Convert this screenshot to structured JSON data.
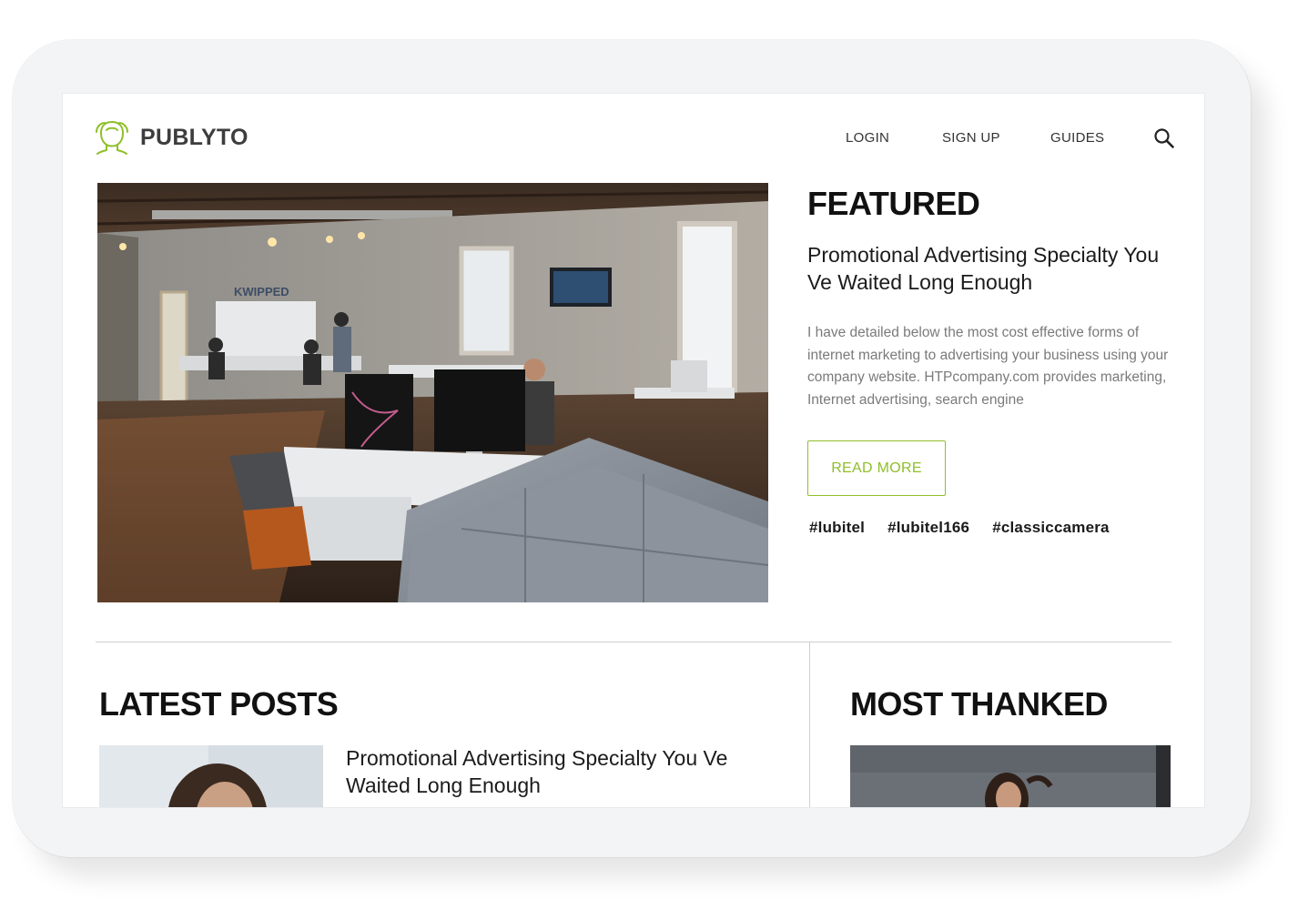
{
  "brand": {
    "name": "PUBLYTO",
    "accent_color": "#8fbf2a"
  },
  "nav": {
    "login": "LOGIN",
    "signup": "SIGN UP",
    "guides": "GUIDES",
    "search_icon": "search-icon"
  },
  "featured": {
    "section_title": "FEATURED",
    "headline": "Promotional Advertising Specialty You Ve Waited Long Enough",
    "excerpt": "I have detailed below the most cost effective forms of internet marketing to advertising your business using your company website. HTPcompany.com provides marketing, Internet advertising, search engine",
    "read_more": "READ MORE",
    "image_sign": "KWIPPED",
    "tags": [
      "#lubitel",
      "#lubitel166",
      "#classiccamera"
    ]
  },
  "latest_posts": {
    "section_title": "LATEST POSTS",
    "items": [
      {
        "headline": "Promotional Advertising Specialty You Ve Waited Long Enough"
      }
    ]
  },
  "most_thanked": {
    "section_title": "MOST THANKED"
  }
}
